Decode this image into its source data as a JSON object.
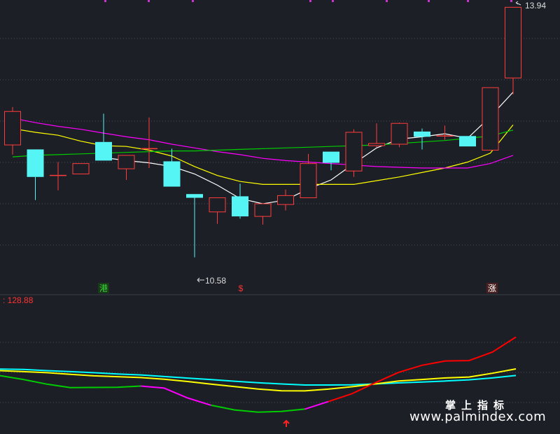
{
  "chart_data": [
    {
      "type": "candlestick",
      "ylim": [
        10.2,
        14.0
      ],
      "grid": true,
      "annotations": {
        "high_label": "13.94",
        "low_label": "10.58",
        "marker_1": "港",
        "marker_2": "$",
        "marker_3": "涨"
      },
      "candles": [
        {
          "open": 12.09,
          "close": 12.54,
          "high": 12.6,
          "low": 11.96
        },
        {
          "open": 12.03,
          "close": 11.66,
          "high": 12.03,
          "low": 11.35
        },
        {
          "open": 11.68,
          "close": 11.68,
          "high": 11.86,
          "low": 11.48
        },
        {
          "open": 11.7,
          "close": 11.84,
          "high": 11.84,
          "low": 11.7
        },
        {
          "open": 12.13,
          "close": 11.88,
          "high": 12.51,
          "low": 11.88
        },
        {
          "open": 11.77,
          "close": 11.95,
          "high": 11.95,
          "low": 11.62
        },
        {
          "open": 12.04,
          "close": 12.04,
          "high": 12.46,
          "low": 11.78
        },
        {
          "open": 11.87,
          "close": 11.53,
          "high": 12.04,
          "low": 11.53
        },
        {
          "open": 11.43,
          "close": 11.38,
          "high": 11.43,
          "low": 10.58
        },
        {
          "open": 11.19,
          "close": 11.38,
          "high": 11.38,
          "low": 11.03
        },
        {
          "open": 11.4,
          "close": 11.13,
          "high": 11.57,
          "low": 11.1
        },
        {
          "open": 11.13,
          "close": 11.3,
          "high": 11.3,
          "low": 11.02
        },
        {
          "open": 11.29,
          "close": 11.41,
          "high": 11.49,
          "low": 11.21
        },
        {
          "open": 11.38,
          "close": 11.84,
          "high": 11.97,
          "low": 11.38
        },
        {
          "open": 12.0,
          "close": 11.85,
          "high": 12.0,
          "low": 11.75
        },
        {
          "open": 11.74,
          "close": 12.26,
          "high": 12.3,
          "low": 11.66
        },
        {
          "open": 12.08,
          "close": 12.11,
          "high": 12.38,
          "low": 12.06
        },
        {
          "open": 12.1,
          "close": 12.38,
          "high": 12.39,
          "low": 12.06
        },
        {
          "open": 12.27,
          "close": 12.2,
          "high": 12.31,
          "low": 12.03
        },
        {
          "open": 12.21,
          "close": 12.21,
          "high": 12.35,
          "low": 12.16
        },
        {
          "open": 12.21,
          "close": 12.07,
          "high": 12.21,
          "low": 12.07
        },
        {
          "open": 12.02,
          "close": 12.86,
          "high": 12.86,
          "low": 12.02
        },
        {
          "open": 12.99,
          "close": 13.94,
          "high": 13.94,
          "low": 12.77
        }
      ],
      "series": [
        {
          "color": "#ffffff",
          "values": [
            null,
            null,
            null,
            null,
            11.92,
            11.88,
            11.85,
            11.8,
            11.7,
            11.55,
            11.37,
            11.3,
            11.35,
            11.5,
            11.62,
            11.84,
            12.05,
            12.17,
            12.2,
            12.24,
            12.18,
            12.47,
            12.8
          ]
        },
        {
          "color": "#ffff00",
          "values": [
            12.31,
            12.26,
            12.22,
            12.14,
            12.08,
            12.07,
            12.02,
            11.94,
            11.8,
            11.68,
            11.6,
            11.56,
            11.56,
            11.56,
            11.56,
            11.56,
            11.61,
            11.66,
            11.72,
            11.78,
            11.86,
            11.98,
            12.36
          ]
        },
        {
          "color": "#ff00ff",
          "values": [
            12.45,
            12.39,
            12.34,
            12.3,
            12.25,
            12.2,
            12.16,
            12.1,
            12.05,
            12.0,
            11.96,
            11.91,
            11.88,
            11.86,
            11.84,
            11.82,
            11.8,
            11.79,
            11.78,
            11.78,
            11.78,
            11.84,
            11.95
          ]
        },
        {
          "color": "#00cc00",
          "values": [
            11.93,
            11.95,
            11.96,
            11.97,
            11.98,
            11.99,
            12.0,
            12.01,
            12.01,
            12.02,
            12.03,
            12.04,
            12.05,
            12.06,
            12.07,
            12.08,
            12.09,
            12.11,
            12.13,
            12.15,
            12.18,
            12.21,
            12.29
          ]
        }
      ]
    },
    {
      "type": "line",
      "ylim": [
        60,
        136
      ],
      "grid": true,
      "value_label": ": 128.88",
      "series": [
        {
          "color": "#00ffff",
          "values": [
            97.5,
            97.3,
            96.6,
            96.0,
            95.4,
            94.7,
            94.1,
            93.2,
            92.3,
            91.4,
            90.5,
            89.6,
            88.9,
            88.3,
            88.3,
            88.4,
            88.9,
            89.5,
            90.0,
            90.6,
            91.3,
            92.4,
            93.8
          ]
        },
        {
          "color": "#ffff00",
          "values": [
            96.6,
            96.0,
            95.4,
            94.5,
            93.6,
            93.1,
            92.6,
            91.6,
            90.3,
            88.8,
            87.4,
            86.0,
            85.0,
            84.9,
            85.9,
            87.3,
            88.9,
            90.6,
            91.5,
            92.4,
            92.9,
            95.1,
            97.6
          ]
        },
        {
          "color_segments": [
            {
              "from": 0,
              "to": 6,
              "color": "#00cc00"
            },
            {
              "from": 6,
              "to": 9,
              "color": "#ff00ff"
            },
            {
              "from": 9,
              "to": 13,
              "color": "#00cc00"
            },
            {
              "from": 13,
              "to": 14,
              "color": "#ff00ff"
            },
            {
              "from": 14,
              "to": 22,
              "color": "#ff0000"
            }
          ],
          "values": [
            93.7,
            91.5,
            88.8,
            86.8,
            86.9,
            87.0,
            87.7,
            86.5,
            80.8,
            76.6,
            73.9,
            72.6,
            73.0,
            74.4,
            78.7,
            83.2,
            89.6,
            95.6,
            99.7,
            102.2,
            102.4,
            107.3,
            116.0
          ]
        }
      ],
      "arrow_index": 13
    }
  ],
  "watermark": {
    "cn": "掌上指标",
    "url": "www.palmindex.com"
  }
}
